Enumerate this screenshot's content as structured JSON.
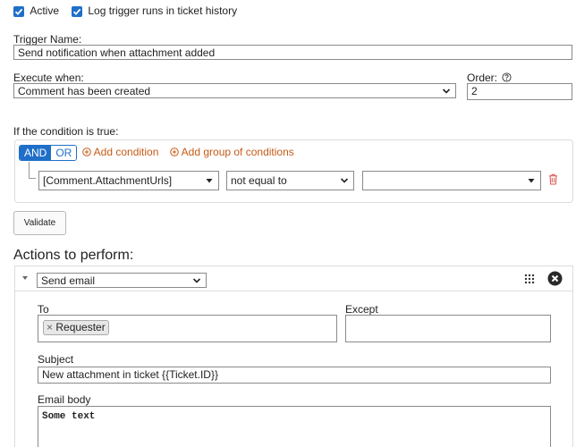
{
  "header": {
    "active_label": "Active",
    "log_label": "Log trigger runs in ticket history"
  },
  "trigger": {
    "name_label": "Trigger Name:",
    "name_value": "Send notification when attachment added",
    "execute_label": "Execute when:",
    "execute_value": "Comment has been created",
    "order_label": "Order:",
    "order_value": "2"
  },
  "conditions": {
    "heading": "If the condition is true:",
    "and_label": "AND",
    "or_label": "OR",
    "add_condition": "Add condition",
    "add_group": "Add group of conditions",
    "field_value": "[Comment.AttachmentUrls]",
    "operator_value": "not equal to",
    "value_value": ""
  },
  "validate_label": "Validate",
  "actions": {
    "heading": "Actions to perform:",
    "action_type": "Send email",
    "to_label": "To",
    "except_label": "Except",
    "recipient_tag": "Requester",
    "subject_label": "Subject",
    "subject_value": "New attachment in ticket {{Ticket.ID}}",
    "body_label": "Email body",
    "body_value": "Some text"
  },
  "colors": {
    "accent": "#1f6fc8",
    "link": "#c65a16",
    "delete": "#d9534f"
  }
}
